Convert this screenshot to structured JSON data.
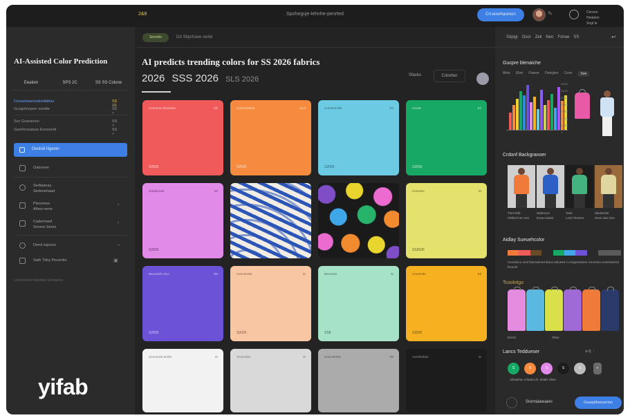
{
  "topbar": {
    "logo": "2&8",
    "center_text": "Spoheguje-lehnhe-penrted",
    "primary_button": "Crt.eoorhaornon",
    "meta": [
      "Ceroen",
      "Hedalon",
      "Sogt la"
    ]
  },
  "sidebar": {
    "title": "AI-Assisted Color Prediction",
    "tabs": [
      "Eeatien",
      "SPS 2C",
      "SS SS Colone"
    ],
    "rows": [
      {
        "label": "Ceouetosercedontbibos",
        "value": "SS 1S",
        "accent": true
      },
      {
        "label": "Gcognhorperr sondte",
        "value": "SS >"
      },
      {
        "label": "Soc Goaranien",
        "value": "SS >"
      },
      {
        "label": "Garehrsoatuss Eonneedt",
        "value": "SS >"
      }
    ],
    "active_item": "Derindi Hgenin",
    "items": [
      {
        "icon": "palette-icon",
        "label": "Oaloorrer"
      },
      {
        "icon": "globe-icon",
        "label": "Serfiaanay",
        "sub": "Sedonehaad"
      },
      {
        "icon": "trend-icon",
        "label": "Plecemes",
        "sub": "Alhes reme"
      },
      {
        "icon": "layers-icon",
        "label": "Cadomoed",
        "sub": "Sonres Seres"
      },
      {
        "icon": "settings-icon",
        "label": "Derol ssjocos"
      },
      {
        "icon": "grid-icon",
        "label": "Sath Tdoy Pecerrtio"
      }
    ],
    "footer_text": "Lneonsond leerdne Uooaeon",
    "brand": "yifab"
  },
  "main": {
    "pill": "Seonsle",
    "sub_text": "Dd Sbpchaoe sedel",
    "title": "AI predicts trending colors for SS 2026 fabrics",
    "seasons": [
      "2026",
      "SSS 2026",
      "SLS 2026"
    ],
    "seg_a": "Sfacks",
    "seg_b": "Colorber",
    "cards": [
      {
        "name": "Ceneorte Aborenee",
        "val": "1/6",
        "code": "S2026",
        "bg": "#f05a5b",
        "fg": "#fff"
      },
      {
        "name": "Corensirsihhr",
        "val": "14.3",
        "code": "S2026",
        "bg": "#f68a3e",
        "fg": "#fff"
      },
      {
        "name": "Curnearcelle",
        "val": "S4",
        "code": "S2026",
        "bg": "#6ccbe3",
        "fg": "#1b3e4a"
      },
      {
        "name": "Hacde",
        "val": "S3",
        "code": "S2026",
        "bg": "#17a865",
        "fg": "#eaffef"
      },
      {
        "name": "Garsbroaie",
        "val": "2S",
        "code": "S2026",
        "bg": "#e28ae8",
        "fg": "#3a1a3e"
      },
      {
        "name": "",
        "val": "",
        "code": "",
        "bg": "zebra",
        "fg": "#fff"
      },
      {
        "name": "",
        "val": "",
        "code": "",
        "bg": "dots",
        "fg": "#fff"
      },
      {
        "name": "Cesnnlor",
        "val": "IS",
        "code": "SS2026",
        "bg": "#e4e26c",
        "fg": "#3a3a10"
      },
      {
        "name": "Beuroeld Lisco",
        "val": "NS",
        "code": "S2026",
        "bg": "#6b52d6",
        "fg": "#efeaff"
      },
      {
        "name": "Cennetorte",
        "val": "IS",
        "code": "S2026",
        "bg": "#f8c6a3",
        "fg": "#5a3a2a"
      },
      {
        "name": "Beeurare",
        "val": "IS",
        "code": "SS8",
        "bg": "#a6e2c7",
        "fg": "#2b4a3c"
      },
      {
        "name": "Creeenbe",
        "val": "S8",
        "code": "S2026",
        "bg": "#f6b020",
        "fg": "#4a3406"
      },
      {
        "name": "Ueonnsea ahnbt",
        "val": "IS",
        "code": "",
        "bg": "#f2f2f2",
        "fg": "#555"
      },
      {
        "name": "Gcionrsbe",
        "val": "IS",
        "code": "",
        "bg": "#d9d9d9",
        "fg": "#555"
      },
      {
        "name": "Unsrcehetie",
        "val": "S5",
        "code": "",
        "bg": "#ababab",
        "fg": "#333"
      },
      {
        "name": "Aorrehnboe",
        "val": "IS",
        "code": "",
        "bg": "#1c1c1c",
        "fg": "#bbb"
      }
    ]
  },
  "right": {
    "menu": [
      "Sdpigi",
      "Osor",
      "Zeil",
      "Neo",
      "Fohae",
      "SS"
    ],
    "h1": "Gucpre blenaiche",
    "tabs": [
      "Meie",
      "Eber",
      "Fiaeee",
      "Oewglee",
      "Ceee"
    ],
    "tab_on": "Soe",
    "chart_y": [
      "S2S0",
      "S1S0",
      "S3S0",
      "S1S0",
      "S1S0",
      "S4S0",
      "S2S0",
      "1"
    ],
    "chart_bars": [
      {
        "v": 0.35,
        "c": "#f05a5b"
      },
      {
        "v": 0.5,
        "c": "#f68a3e"
      },
      {
        "v": 0.62,
        "c": "#e9d52d"
      },
      {
        "v": 0.78,
        "c": "#17a865"
      },
      {
        "v": 0.7,
        "c": "#2f8de0"
      },
      {
        "v": 0.9,
        "c": "#6b52d6"
      },
      {
        "v": 0.55,
        "c": "#e28ae8"
      },
      {
        "v": 0.66,
        "c": "#f6b020"
      },
      {
        "v": 0.42,
        "c": "#6ccbe3"
      },
      {
        "v": 0.8,
        "c": "#8b5cf6"
      },
      {
        "v": 0.5,
        "c": "#d0d050"
      },
      {
        "v": 0.6,
        "c": "#f05a5b"
      },
      {
        "v": 0.72,
        "c": "#17a865"
      },
      {
        "v": 0.45,
        "c": "#3fa6e8"
      },
      {
        "v": 0.86,
        "c": "#a855f7"
      },
      {
        "v": 0.58,
        "c": "#f68a3e"
      },
      {
        "v": 0.69,
        "c": "#e9d52d"
      }
    ],
    "h2": "Crdonf Backgranoer",
    "photos": [
      {
        "body": "#f07a3a",
        "bg": "#cfcfcf",
        "cap": [
          "Tloel Ibtb",
          "Ghibel lonn ses"
        ]
      },
      {
        "body": "#2e5fc4",
        "bg": "#cfcfcf",
        "cap": [
          "Stdesioor",
          "Eone-Lbaes"
        ]
      },
      {
        "body": "#45b37f",
        "bg": "#1d1d1d",
        "cap": [
          "Taeb",
          "Loscl lmeees"
        ]
      },
      {
        "body": "#e0d6a0",
        "bg": "#9b6a3c",
        "cap": [
          "Slaoberlal",
          "Soun lsas Ses"
        ]
      }
    ],
    "h3": "Aidlay Sueuehcolor",
    "swatches": [
      "#f07a3a",
      "#f05a5b",
      "#6b4a2a",
      "#2a2a2a",
      "#17a865",
      "#3fa6e8",
      "#6b52d6",
      "#2a2a2a",
      "#5a5a5a",
      "#5a5a5a"
    ],
    "h3_text": "Cecedcno onel Ihat Iaened dnect anlueed s ceognrotsnee Cecereco sonerlantice Doocte",
    "h4": "Tcoolotgo",
    "garments": [
      "#e58be0",
      "#5bb8e0",
      "#d9e04a",
      "#a06ad6",
      "#f07a3a",
      "#2a3a6a"
    ],
    "garment_caps": [
      "Eorcd",
      "Shan"
    ],
    "h5": "Lancs Teddueser",
    "dots": [
      {
        "c": "#17a865",
        "t": "S"
      },
      {
        "c": "#f68a3e",
        "t": "S"
      },
      {
        "c": "#e28ae8",
        "t": "S"
      },
      {
        "c": "#1c1c1c",
        "t": "S"
      },
      {
        "c": "#bdbdbd",
        "t": "S"
      },
      {
        "c": "#6b6b6b",
        "t": "+"
      }
    ],
    "dots_caption": "Ebsiarlon crlaalccoh: ahalle ebee",
    "secondary_button": "Srerniaieeaeni",
    "primary_button": "Geseptheoserion"
  }
}
